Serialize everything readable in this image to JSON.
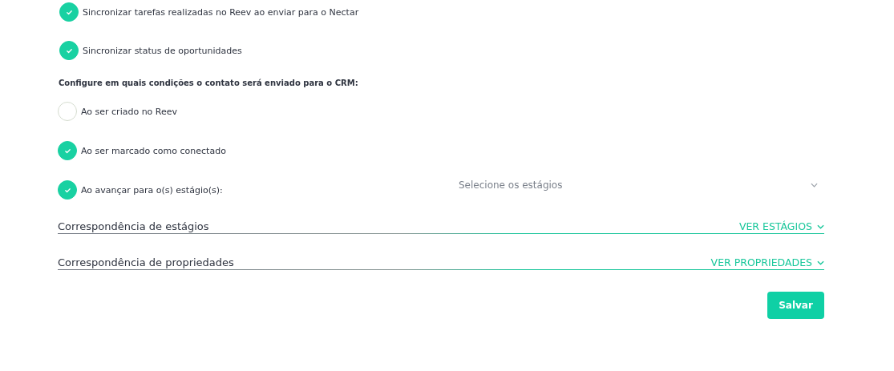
{
  "sync_options": [
    {
      "label": "Sincronizar tarefas realizadas no Reev ao enviar para o Nectar",
      "checked": true
    },
    {
      "label": "Sincronizar status de oportunidades",
      "checked": true
    }
  ],
  "conditions_heading": "Configure em quais condições o contato será enviado para o CRM:",
  "conditions": [
    {
      "label": "Ao ser criado no Reev",
      "checked": false
    },
    {
      "label": "Ao ser marcado como conectado",
      "checked": true
    },
    {
      "label": "Ao avançar para o(s) estágio(s):",
      "checked": true
    }
  ],
  "stage_select": {
    "placeholder": "Selecione os estágios"
  },
  "sections": [
    {
      "title": "Correspondência de estágios",
      "toggle": "VER ESTÁGIOS",
      "expanded": false
    },
    {
      "title": "Correspondência de propriedades",
      "toggle": "VER PROPRIEDADES",
      "expanded": false
    }
  ],
  "save_button": "Salvar"
}
